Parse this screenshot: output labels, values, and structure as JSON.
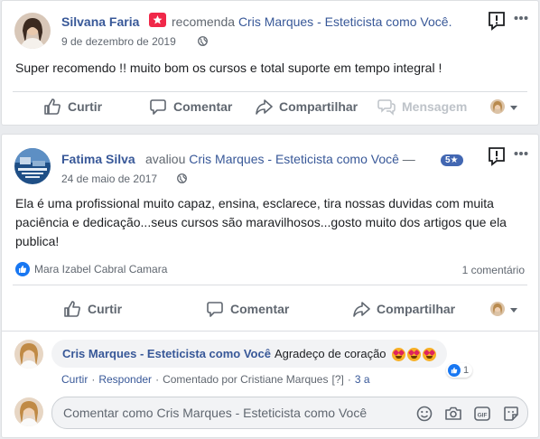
{
  "post1": {
    "author": "Silvana Faria",
    "verb": "recomenda",
    "page": "Cris Marques - Esteticista como Você.",
    "date": "9 de dezembro de 2019",
    "text": "Super recomendo !! muito bom os cursos e total suporte em tempo integral !",
    "actions": {
      "like": "Curtir",
      "comment": "Comentar",
      "share": "Compartilhar",
      "message": "Mensagem"
    }
  },
  "post2": {
    "author": "Fatima Silva",
    "verb": "avaliou",
    "page": "Cris Marques - Esteticista como Você",
    "dash": "—",
    "rating": "5★",
    "date": "24 de maio de 2017",
    "text": "Ela é uma profissional muito capaz, ensina, esclarece, tira nossas duvidas com muita paciência e dedicação...seus cursos são maravilhosos...gosto muito dos artigos que ela publica!",
    "reaction_by": "Mara Izabel Cabral Camara",
    "comments_count": "1 comentário",
    "actions": {
      "like": "Curtir",
      "comment": "Comentar",
      "share": "Compartilhar"
    }
  },
  "comment": {
    "author": "Cris Marques - Esteticista como Você",
    "text": "Agradeço de coração",
    "like": "Curtir",
    "reply": "Responder",
    "commented_by": "Comentado por Cristiane Marques",
    "help": "[?]",
    "age": "3 a",
    "reaction_count": "1"
  },
  "composer": {
    "placeholder": "Comentar como Cris Marques - Esteticista como Você"
  },
  "colors": {
    "link": "#385898",
    "like_blue": "#1877f2",
    "rating_badge": "#4267b2",
    "recommend_red": "#f02849"
  }
}
